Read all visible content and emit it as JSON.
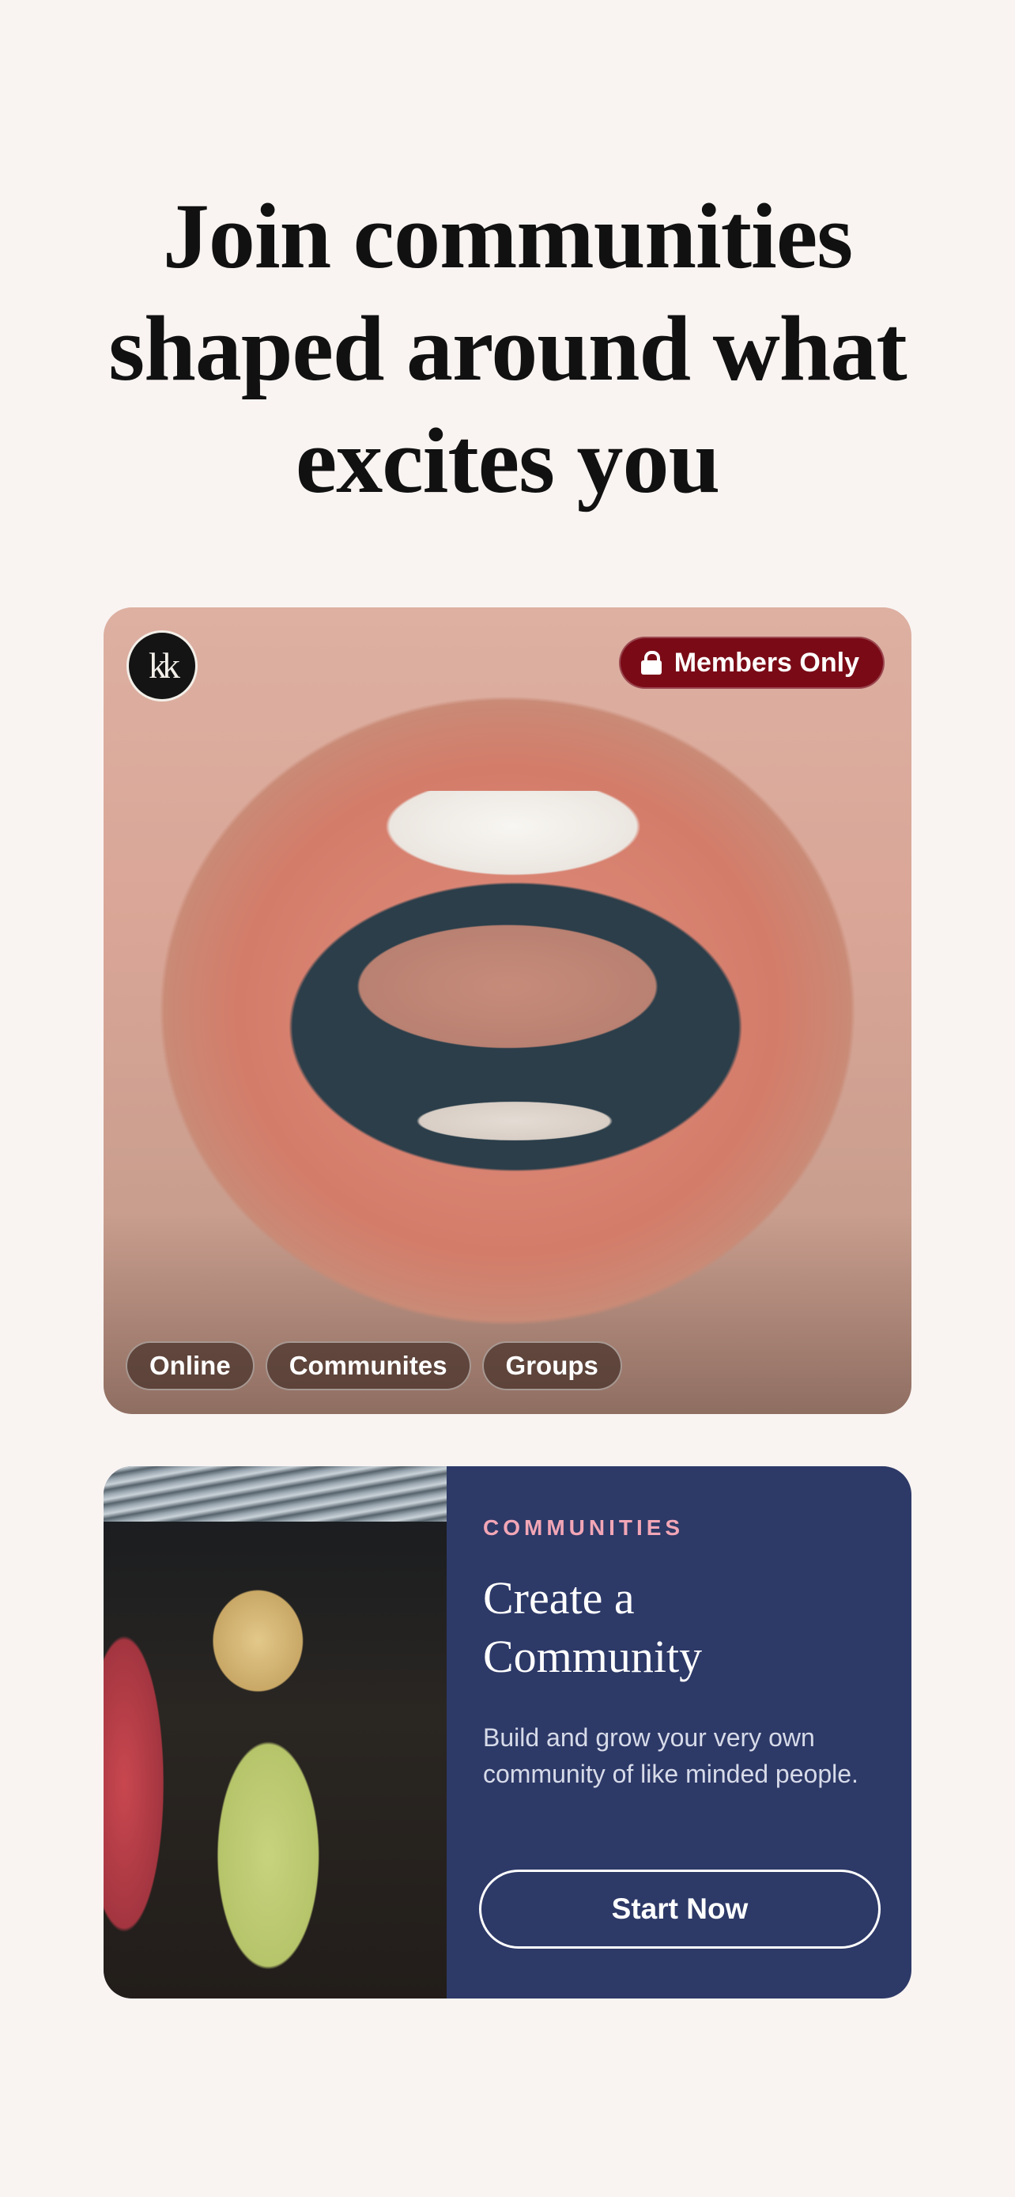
{
  "headline": {
    "line1": "Join communities",
    "line2": "shaped around what",
    "line3": "excites you"
  },
  "hero_card": {
    "logo_text": "kk",
    "members_badge": "Members Only",
    "lock_icon": "lock-icon",
    "tags": [
      "Online",
      "Communites",
      "Groups"
    ]
  },
  "community_card": {
    "eyebrow": "COMMUNITIES",
    "title_line1": "Create a",
    "title_line2": "Community",
    "description": "Build and grow your very own community of like minded people.",
    "button_label": "Start Now"
  },
  "colors": {
    "background": "#f9f4f2",
    "card_navy": "#2d3967",
    "badge_red": "#7a0b16",
    "eyebrow_pink": "#f2a6b6"
  }
}
